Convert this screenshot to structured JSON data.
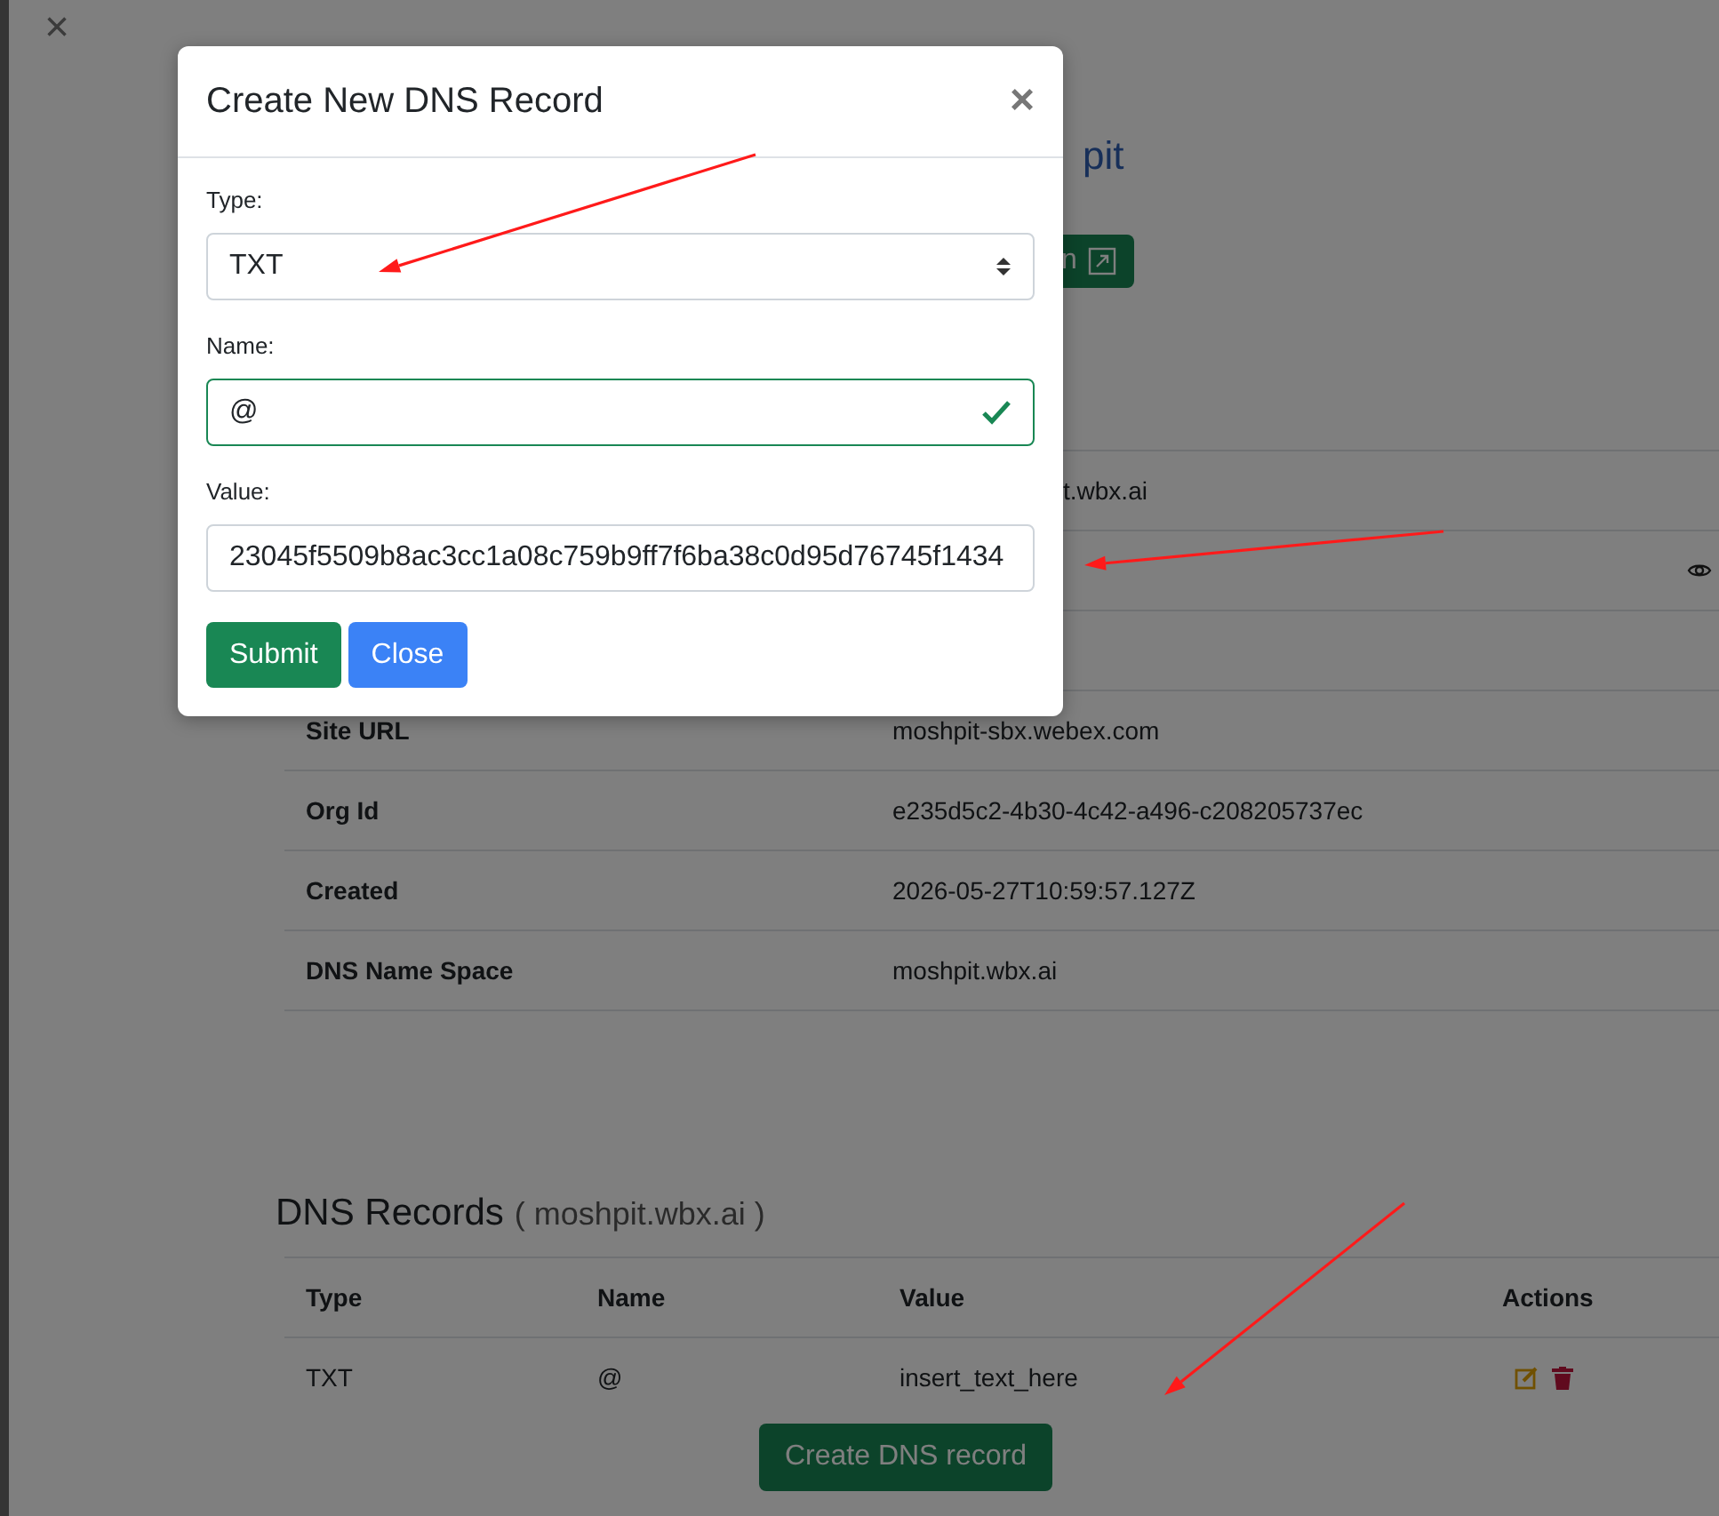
{
  "page": {
    "close_icon": "×",
    "title_fragment": "pit",
    "open_button_fragment": "n",
    "details_covered": [
      {
        "value_fragment": "t.wbx.ai",
        "reveal_icon": false
      },
      {
        "reveal_icon": true
      },
      {
        "reveal_icon": false
      }
    ],
    "details": [
      {
        "label": "Site URL",
        "value": "moshpit-sbx.webex.com"
      },
      {
        "label": "Org Id",
        "value": "e235d5c2-4b30-4c42-a496-c208205737ec"
      },
      {
        "label": "Created",
        "value": "2026-05-27T10:59:57.127Z"
      },
      {
        "label": "DNS Name Space",
        "value": "moshpit.wbx.ai"
      }
    ],
    "dns_records": {
      "title": "DNS Records",
      "domain": "( moshpit.wbx.ai )",
      "columns": [
        "Type",
        "Name",
        "Value",
        "Actions"
      ],
      "rows": [
        {
          "type": "TXT",
          "name": "@",
          "value": "insert_text_here"
        }
      ],
      "create_button": "Create DNS record"
    }
  },
  "dialog": {
    "title": "Create New DNS Record",
    "close": "×",
    "fields": [
      {
        "kind": "select",
        "label": "Type:",
        "value": "TXT",
        "valid": false
      },
      {
        "kind": "text",
        "label": "Name:",
        "value": "@",
        "valid": true
      },
      {
        "kind": "text",
        "label": "Value:",
        "value": "23045f5509b8ac3cc1a08c759b9ff7f6ba38c0d95d76745f1434",
        "valid": false
      }
    ],
    "buttons": [
      {
        "label": "Submit",
        "kind": "primary"
      },
      {
        "label": "Close",
        "kind": "secondary"
      }
    ]
  }
}
